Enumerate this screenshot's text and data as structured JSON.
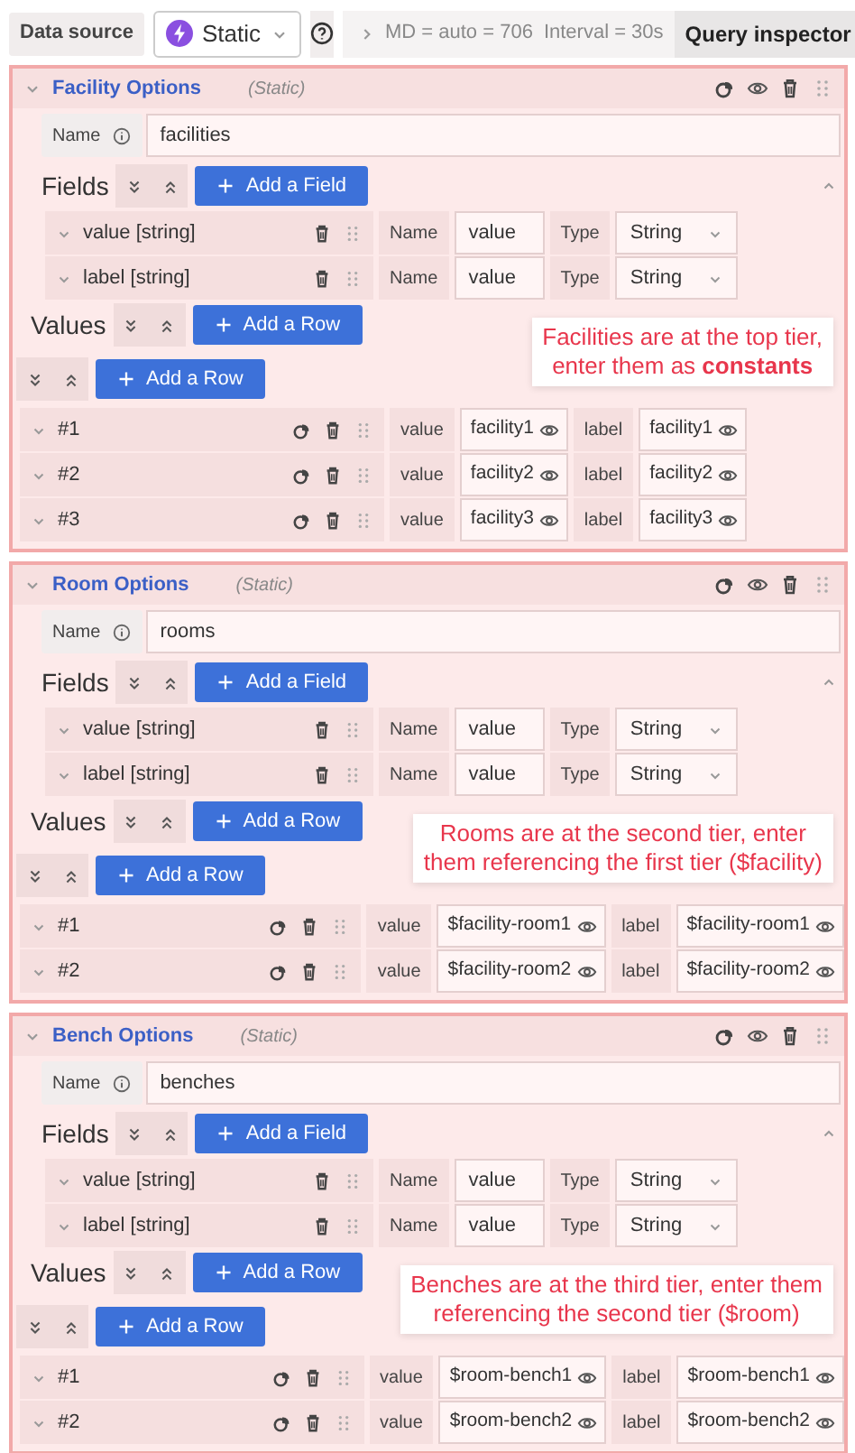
{
  "toolbar": {
    "label": "Data source",
    "datasource": "Static",
    "md": "MD = auto = 706",
    "interval": "Interval = 30s",
    "inspector": "Query inspector"
  },
  "queries": [
    {
      "title": "Facility Options",
      "source": "(Static)",
      "name_label": "Name",
      "name": "facilities",
      "fields_label": "Fields",
      "add_field": "Add a Field",
      "fields": [
        {
          "title": "value [string]",
          "name_label": "Name",
          "name": "value",
          "type_label": "Type",
          "type": "String"
        },
        {
          "title": "label [string]",
          "name_label": "Name",
          "name": "value",
          "type_label": "Type",
          "type": "String"
        }
      ],
      "values_label": "Values",
      "add_row": "Add a Row",
      "add_row_2": "Add a Row",
      "note": [
        "Facilities are at the top tier,",
        "enter them as **constants**"
      ],
      "rows": [
        {
          "title": "#1",
          "cells": [
            {
              "label": "value",
              "value": "facility1"
            },
            {
              "label": "label",
              "value": "facility1"
            }
          ]
        },
        {
          "title": "#2",
          "cells": [
            {
              "label": "value",
              "value": "facility2"
            },
            {
              "label": "label",
              "value": "facility2"
            }
          ]
        },
        {
          "title": "#3",
          "cells": [
            {
              "label": "value",
              "value": "facility3"
            },
            {
              "label": "label",
              "value": "facility3"
            }
          ]
        }
      ]
    },
    {
      "title": "Room Options",
      "source": "(Static)",
      "name_label": "Name",
      "name": "rooms",
      "fields_label": "Fields",
      "add_field": "Add a Field",
      "fields": [
        {
          "title": "value [string]",
          "name_label": "Name",
          "name": "value",
          "type_label": "Type",
          "type": "String"
        },
        {
          "title": "label [string]",
          "name_label": "Name",
          "name": "value",
          "type_label": "Type",
          "type": "String"
        }
      ],
      "values_label": "Values",
      "add_row": "Add a Row",
      "add_row_2": "Add a Row",
      "note": [
        "Rooms are at the second tier, enter",
        "them referencing the first tier ($facility)"
      ],
      "rows": [
        {
          "title": "#1",
          "cells": [
            {
              "label": "value",
              "value": "$facility-room1"
            },
            {
              "label": "label",
              "value": "$facility-room1"
            }
          ]
        },
        {
          "title": "#2",
          "cells": [
            {
              "label": "value",
              "value": "$facility-room2"
            },
            {
              "label": "label",
              "value": "$facility-room2"
            }
          ]
        }
      ]
    },
    {
      "title": "Bench Options",
      "source": "(Static)",
      "name_label": "Name",
      "name": "benches",
      "fields_label": "Fields",
      "add_field": "Add a Field",
      "fields": [
        {
          "title": "value [string]",
          "name_label": "Name",
          "name": "value",
          "type_label": "Type",
          "type": "String"
        },
        {
          "title": "label [string]",
          "name_label": "Name",
          "name": "value",
          "type_label": "Type",
          "type": "String"
        }
      ],
      "values_label": "Values",
      "add_row": "Add a Row",
      "add_row_2": "Add a Row",
      "note": [
        "Benches are at the third tier, enter them",
        "referencing the second tier ($room)"
      ],
      "rows": [
        {
          "title": "#1",
          "cells": [
            {
              "label": "value",
              "value": "$room-bench1"
            },
            {
              "label": "label",
              "value": "$room-bench1"
            }
          ]
        },
        {
          "title": "#2",
          "cells": [
            {
              "label": "value",
              "value": "$room-bench2"
            },
            {
              "label": "label",
              "value": "$room-bench2"
            }
          ]
        }
      ]
    }
  ]
}
